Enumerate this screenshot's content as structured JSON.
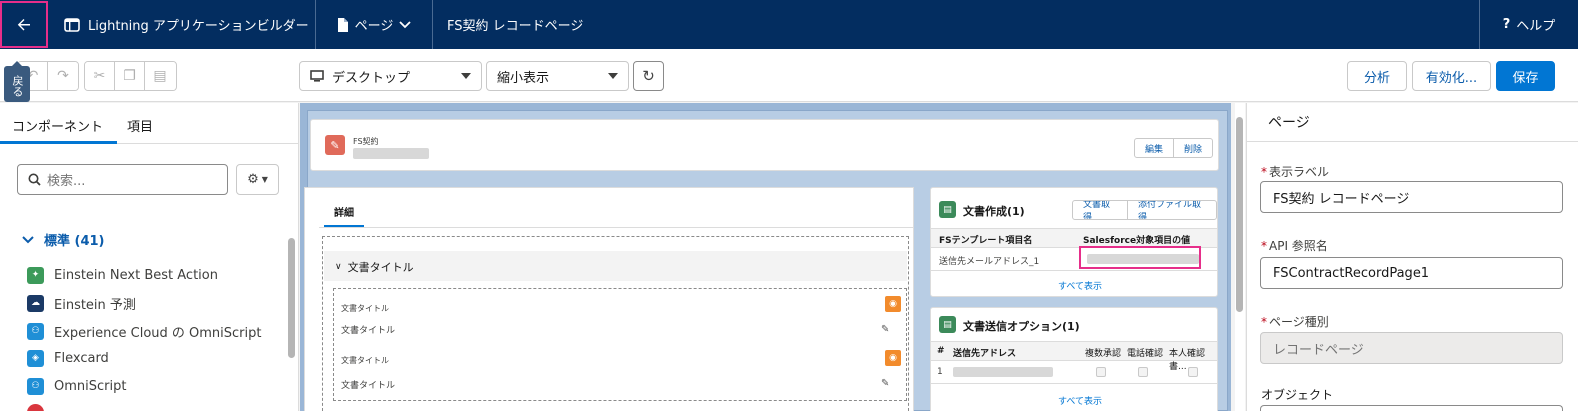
{
  "topbar": {
    "back_icon": "arrow-left-icon",
    "app_title": "Lightning アプリケーションビルダー",
    "page_menu": "ページ",
    "record_page": "FS契約 レコードページ",
    "help": "ヘルプ",
    "back_tooltip": "戻る"
  },
  "toolbar": {
    "device": "デスクトップ",
    "view": "縮小表示",
    "analyze": "分析",
    "activate": "有効化...",
    "save": "保存"
  },
  "left": {
    "tabs": [
      "コンポーネント",
      "項目"
    ],
    "search_placeholder": "検索...",
    "section": "標準 (41)",
    "components": [
      {
        "label": "Einstein Next Best Action",
        "color": "#3c9a5a"
      },
      {
        "label": "Einstein 予測",
        "color": "#1b3a66"
      },
      {
        "label": "Experience Cloud の OmniScript",
        "color": "#1f8fd6"
      },
      {
        "label": "Flexcard",
        "color": "#1f8fd6"
      },
      {
        "label": "OmniScript",
        "color": "#1f8fd6"
      }
    ]
  },
  "canvas": {
    "record_object": "FS契約",
    "edit": "編集",
    "delete": "削除",
    "detail_tab": "詳細",
    "section_title": "文書タイトル",
    "field1_label": "文書タイトル",
    "field1_value": "文書タイトル",
    "field2_label": "文書タイトル",
    "field2_value": "文書タイトル",
    "doc_card": {
      "title": "文書作成(1)",
      "btn1": "文書取得",
      "btn2": "添付ファイル取得",
      "col1": "FSテンプレート項目名",
      "col2": "Salesforce対象項目の値",
      "row1": "送信先メールアドレス_1",
      "view_all": "すべて表示"
    },
    "opt_card": {
      "title": "文書送信オプション(1)",
      "col_num": "#",
      "col_addr": "送信先アドレス",
      "col_a": "複数承認",
      "col_b": "電話確認",
      "col_c": "本人確認書...",
      "row_num": "1",
      "view_all": "すべて表示"
    }
  },
  "right": {
    "title": "ページ",
    "label_field": "表示ラベル",
    "label_value": "FS契約 レコードページ",
    "api_field": "API 参照名",
    "api_value": "FSContractRecordPage1",
    "type_field": "ページ種別",
    "type_value": "レコードページ",
    "object_field": "オブジェクト"
  }
}
